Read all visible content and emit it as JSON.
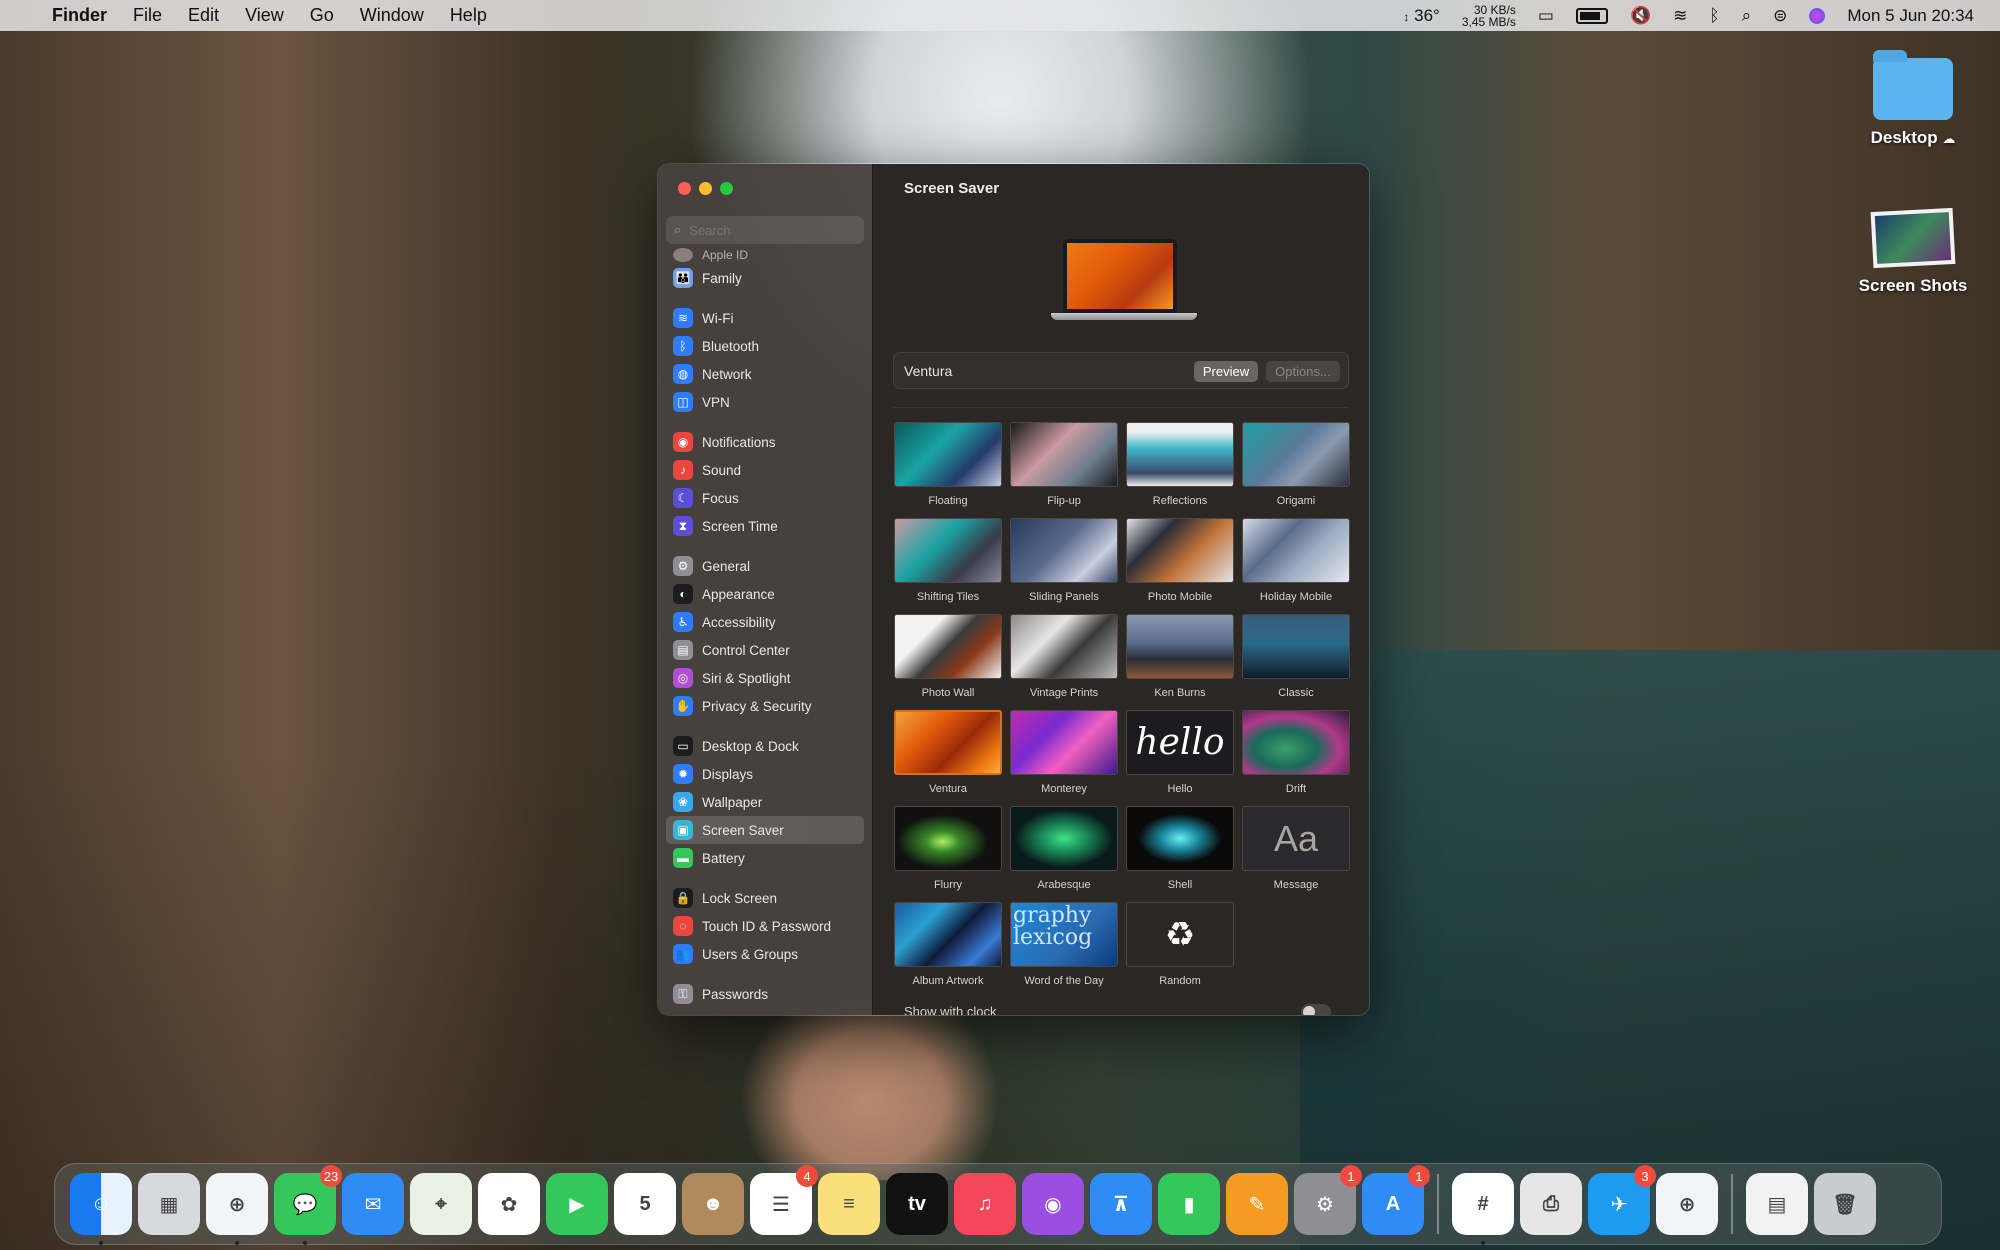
{
  "menubar": {
    "apple_icon": "apple-icon",
    "app_name": "Finder",
    "menus": [
      "File",
      "Edit",
      "View",
      "Go",
      "Window",
      "Help"
    ],
    "temperature": "36°",
    "net_up": "30 KB/s",
    "net_down": "3,45 MB/s",
    "datetime": "Mon 5 Jun  20:34"
  },
  "desktop": {
    "icons": [
      {
        "label": "Desktop",
        "icon": "folder-icon"
      },
      {
        "label": "Screen Shots",
        "icon": "screenshot-image-icon"
      }
    ]
  },
  "window": {
    "search_placeholder": "Search",
    "sidebar": {
      "partial_item": "Apple ID",
      "groups": [
        [
          {
            "label": "Family",
            "color": "#6d9ee8",
            "glyph": "👪"
          }
        ],
        [
          {
            "label": "Wi-Fi",
            "color": "#2e7cf6",
            "glyph": "≋"
          },
          {
            "label": "Bluetooth",
            "color": "#2e7cf6",
            "glyph": "ᛒ"
          },
          {
            "label": "Network",
            "color": "#2e7cf6",
            "glyph": "◍"
          },
          {
            "label": "VPN",
            "color": "#2e7cf6",
            "glyph": "◫"
          }
        ],
        [
          {
            "label": "Notifications",
            "color": "#e8473f",
            "glyph": "◉"
          },
          {
            "label": "Sound",
            "color": "#e8473f",
            "glyph": "♪"
          },
          {
            "label": "Focus",
            "color": "#5b4fd6",
            "glyph": "☾"
          },
          {
            "label": "Screen Time",
            "color": "#5b4fd6",
            "glyph": "⧗"
          }
        ],
        [
          {
            "label": "General",
            "color": "#8e8e93",
            "glyph": "⚙"
          },
          {
            "label": "Appearance",
            "color": "#1c1c1e",
            "glyph": "◐"
          },
          {
            "label": "Accessibility",
            "color": "#2e7cf6",
            "glyph": "♿"
          },
          {
            "label": "Control Center",
            "color": "#8e8e93",
            "glyph": "▤"
          },
          {
            "label": "Siri & Spotlight",
            "color": "#b04fd6",
            "glyph": "◎"
          },
          {
            "label": "Privacy & Security",
            "color": "#2e7cf6",
            "glyph": "✋"
          }
        ],
        [
          {
            "label": "Desktop & Dock",
            "color": "#1c1c1e",
            "glyph": "▭"
          },
          {
            "label": "Displays",
            "color": "#2e7cf6",
            "glyph": "✹"
          },
          {
            "label": "Wallpaper",
            "color": "#3aa7e8",
            "glyph": "❀"
          },
          {
            "label": "Screen Saver",
            "color": "#3ab4d8",
            "glyph": "▣",
            "selected": true
          },
          {
            "label": "Battery",
            "color": "#34c759",
            "glyph": "▬"
          }
        ],
        [
          {
            "label": "Lock Screen",
            "color": "#1c1c1e",
            "glyph": "🔒"
          },
          {
            "label": "Touch ID & Password",
            "color": "#e8473f",
            "glyph": "◌"
          },
          {
            "label": "Users & Groups",
            "color": "#2e7cf6",
            "glyph": "👥"
          }
        ],
        [
          {
            "label": "Passwords",
            "color": "#8e8e93",
            "glyph": "⚿"
          }
        ]
      ]
    },
    "main": {
      "title": "Screen Saver",
      "selected_saver": "Ventura",
      "preview_label": "Preview",
      "options_label": "Options...",
      "savers": [
        {
          "label": "Floating",
          "bg": "linear-gradient(135deg,#0b5a5a,#1aa3a3 40%,#223a6a 70%,#c9cde0)"
        },
        {
          "label": "Flip-up",
          "bg": "linear-gradient(135deg,#1b1b1b,#c99aa0 40%,#6d7f8f 70%,#1b1b1b)"
        },
        {
          "label": "Reflections",
          "bg": "linear-gradient(180deg,#ecedef 0,#ecedef 15%,#3fb8c8 40%,#3b4a6a 80%,#ecedef 100%)"
        },
        {
          "label": "Origami",
          "bg": "linear-gradient(135deg,#1aa0a0,#5a7a9a 45%,#8a9ab0 65%,#2b2e3a)"
        },
        {
          "label": "Shifting Tiles",
          "bg": "linear-gradient(135deg,#c99aa0,#1aa3a3 40%,#3a3a4a 70%,#8a8a9a)"
        },
        {
          "label": "Sliding Panels",
          "bg": "linear-gradient(135deg,#2a3a5a,#5a6a8a 45%,#c9cde0 75%,#3a4a6a)"
        },
        {
          "label": "Photo Mobile",
          "bg": "linear-gradient(135deg,#e0e2e6,#2a2d36 30%,#c2753a 60%,#e0e2e6)"
        },
        {
          "label": "Holiday Mobile",
          "bg": "linear-gradient(135deg,#d8dce6,#5a6a8a 35%,#9aaac0 60%,#e6e8ee)"
        },
        {
          "label": "Photo Wall",
          "bg": "linear-gradient(135deg,#f2f2f2,#f2f2f2 30%,#3a3a3a 50%,#8a3a1a 70%,#f2f2f2)"
        },
        {
          "label": "Vintage Prints",
          "bg": "linear-gradient(135deg,#8a8a8a,#e6e6e6 35%,#3a3a3a 60%,#bdbdbd)"
        },
        {
          "label": "Ken Burns",
          "bg": "linear-gradient(180deg,#8a9ab0,#5a6a8a 45%,#2a2d36 70%,#8a5a3a)"
        },
        {
          "label": "Classic",
          "bg": "linear-gradient(180deg,#3a5a7a,#2a6a8a 45%,#1a3a4a 80%,#0a1a2a)"
        },
        {
          "label": "Ventura",
          "bg": "linear-gradient(135deg,#f6a23a,#e0560a 35%,#9a2a0a 60%,#f07a12 85%,#f6b23a)",
          "selected": true
        },
        {
          "label": "Monterey",
          "bg": "linear-gradient(135deg,#c02ab0,#7a2ad0 35%,#f060c0 60%,#3a1a8a 100%)"
        },
        {
          "label": "Hello",
          "bg": "#1c1c1e",
          "text": "hello"
        },
        {
          "label": "Drift",
          "bg": "radial-gradient(ellipse at 40% 60%,#3aa06a,#1a6a5a 35%,#b03a8a 60%,#2a1a3a 100%)"
        },
        {
          "label": "Flurry",
          "bg": "radial-gradient(ellipse at 45% 55%,#b0f060,#3a8a2a 20%,#101010 55%)"
        },
        {
          "label": "Arabesque",
          "bg": "radial-gradient(ellipse at 50% 50%,#40e080,#1a8a5a 30%,#0a1a1a 65%)"
        },
        {
          "label": "Shell",
          "bg": "radial-gradient(ellipse at 50% 50%,#6af0f0,#1a8aa0 25%,#0a0a0a 55%)"
        },
        {
          "label": "Message",
          "bg": "#2a2a2c",
          "text": "Aa"
        },
        {
          "label": "Album Artwork",
          "bg": "linear-gradient(135deg,#1a5aa0,#2aa0d0 30%,#101a3a 55%,#3a7ad0 80%,#0a1a3a)"
        },
        {
          "label": "Word of the Day",
          "bg": "linear-gradient(135deg,#1a8ad8,#2a6ab0 60%,#0a3a7a)",
          "text": "graphy lexicog"
        },
        {
          "label": "Random",
          "bg": "#2b2725",
          "glyph": "♻"
        }
      ],
      "show_clock_label": "Show with clock"
    }
  },
  "dock": {
    "apps": [
      {
        "name": "finder",
        "color": "linear-gradient(90deg,#1a7af0 50%,#e6f2ff 50%)",
        "glyph": "☺",
        "running": true
      },
      {
        "name": "launchpad",
        "color": "#d7d9de",
        "glyph": "▦"
      },
      {
        "name": "safari",
        "color": "#f2f4f7",
        "glyph": "⊕",
        "running": true
      },
      {
        "name": "messages",
        "color": "#34c759",
        "glyph": "💬",
        "badge": "23",
        "running": true
      },
      {
        "name": "mail",
        "color": "#2f8bf6",
        "glyph": "✉"
      },
      {
        "name": "maps",
        "color": "#e9f0e4",
        "glyph": "⌖"
      },
      {
        "name": "photos",
        "color": "#ffffff",
        "glyph": "✿"
      },
      {
        "name": "facetime",
        "color": "#34c759",
        "glyph": "▶"
      },
      {
        "name": "calendar",
        "color": "#ffffff",
        "glyph": "5"
      },
      {
        "name": "contacts",
        "color": "#b08a5a",
        "glyph": "☻"
      },
      {
        "name": "reminders",
        "color": "#ffffff",
        "glyph": "☰",
        "badge": "4"
      },
      {
        "name": "notes",
        "color": "#f9e07a",
        "glyph": "≡"
      },
      {
        "name": "tv",
        "color": "#111111",
        "glyph": "tv"
      },
      {
        "name": "music",
        "color": "#f2485a",
        "glyph": "♫"
      },
      {
        "name": "podcasts",
        "color": "#9b4fe0",
        "glyph": "◉"
      },
      {
        "name": "keynote",
        "color": "#2f8bf6",
        "glyph": "⊼"
      },
      {
        "name": "numbers",
        "color": "#34c759",
        "glyph": "▮"
      },
      {
        "name": "pages",
        "color": "#f59a23",
        "glyph": "✎"
      },
      {
        "name": "system-settings",
        "color": "#8e8e93",
        "glyph": "⚙",
        "badge": "1"
      },
      {
        "name": "app-store",
        "color": "#2f8bf6",
        "glyph": "A",
        "badge": "1"
      },
      {
        "name": "separator"
      },
      {
        "name": "slack",
        "color": "#ffffff",
        "glyph": "#",
        "running": true
      },
      {
        "name": "printer",
        "color": "#e6e6e6",
        "glyph": "⎙"
      },
      {
        "name": "twitter",
        "color": "#1d9bf0",
        "glyph": "✈",
        "badge": "3"
      },
      {
        "name": "safari-technology-preview",
        "color": "#f2f4f7",
        "glyph": "⊕"
      },
      {
        "name": "separator"
      },
      {
        "name": "documents-stack",
        "color": "#f2f2f2",
        "glyph": "▤"
      },
      {
        "name": "trash",
        "color": "#c8cbd0",
        "glyph": "🗑"
      }
    ]
  }
}
